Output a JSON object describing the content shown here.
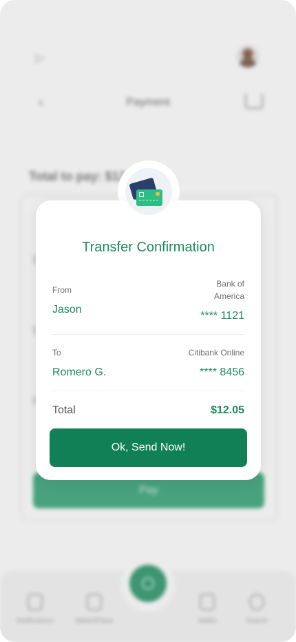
{
  "background_screen": {
    "title": "Payment",
    "total_to_pay": "Total to pay: $12.05",
    "pay_button_label": "Pay"
  },
  "bottom_nav": {
    "items": [
      {
        "label": "Notifications",
        "icon": "bell-icon"
      },
      {
        "label": "MarketPlace",
        "icon": "store-icon"
      },
      {
        "label": "Wallet",
        "icon": "wallet-icon"
      },
      {
        "label": "Search",
        "icon": "search-icon"
      }
    ],
    "fab_icon": "globe-icon"
  },
  "modal": {
    "title": "Transfer Confirmation",
    "icon": "credit-card-icon",
    "from": {
      "label": "From",
      "name": "Jason",
      "bank_line1": "Bank of",
      "bank_line2": "America",
      "account": "**** 1121"
    },
    "to": {
      "label": "To",
      "name": "Romero G.",
      "bank": "Citibank Online",
      "account": "**** 8456"
    },
    "total_label": "Total",
    "total_value": "$12.05",
    "confirm_button_label": "Ok, Send Now!"
  },
  "colors": {
    "accent_green": "#1d8a5e",
    "button_green": "#128056"
  }
}
